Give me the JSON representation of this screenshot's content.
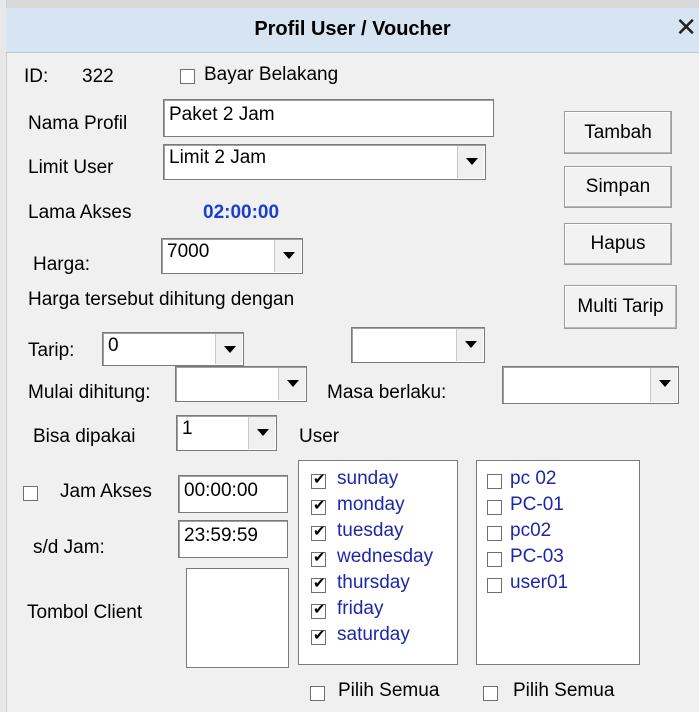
{
  "window": {
    "title": "Profil User / Voucher",
    "close_glyph": "✕"
  },
  "id_label": "ID:",
  "id_value": "322",
  "bayar_belakang": {
    "label": "Bayar Belakang",
    "checked": false
  },
  "nama_profil": {
    "label": "Nama Profil",
    "value": "Paket 2 Jam"
  },
  "limit_user": {
    "label": "Limit User",
    "value": "Limit 2 Jam"
  },
  "lama_akses": {
    "label": "Lama Akses",
    "value": "02:00:00"
  },
  "harga": {
    "label": "Harga:",
    "value": "7000"
  },
  "harga_note": "Harga tersebut dihitung dengan",
  "tarip": {
    "label": "Tarip:",
    "value": "0",
    "second_value": ""
  },
  "mulai_dihitung": {
    "label": "Mulai dihitung:",
    "value": ""
  },
  "masa_berlaku": {
    "label": "Masa berlaku:",
    "value": ""
  },
  "bisa_dipakai": {
    "label": "Bisa dipakai",
    "value": "1"
  },
  "user_label": "User",
  "jam_akses": {
    "label": "Jam Akses",
    "checked": false,
    "value": "00:00:00"
  },
  "sd_jam": {
    "label": "s/d Jam:",
    "value": "23:59:59"
  },
  "tombol_client": {
    "label": "Tombol Client"
  },
  "buttons": {
    "tambah": "Tambah",
    "simpan": "Simpan",
    "hapus": "Hapus",
    "multi_tarip": "Multi Tarip"
  },
  "days": [
    {
      "label": "sunday",
      "checked": true
    },
    {
      "label": "monday",
      "checked": true
    },
    {
      "label": "tuesday",
      "checked": true
    },
    {
      "label": "wednesday",
      "checked": true
    },
    {
      "label": "thursday",
      "checked": true
    },
    {
      "label": "friday",
      "checked": true
    },
    {
      "label": "saturday",
      "checked": true
    }
  ],
  "users": [
    {
      "label": "pc 02",
      "checked": false
    },
    {
      "label": "PC-01",
      "checked": false
    },
    {
      "label": "pc02",
      "checked": false
    },
    {
      "label": "PC-03",
      "checked": false
    },
    {
      "label": "user01",
      "checked": false
    }
  ],
  "pilih_semua_days": {
    "label": "Pilih Semua",
    "checked": false
  },
  "pilih_semua_users": {
    "label": "Pilih Semua",
    "checked": false
  },
  "colors": {
    "accent_time": "#1a3fd0",
    "list_text": "#1c28a8",
    "titlebar": "#d7e4f2"
  }
}
